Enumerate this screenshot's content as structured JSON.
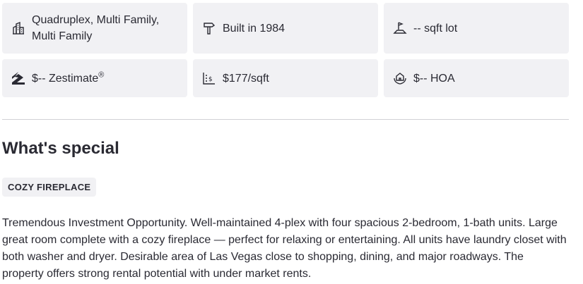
{
  "facts": [
    {
      "icon": "building-icon",
      "text": "Quadruplex, Multi Family, Multi Family"
    },
    {
      "icon": "hammer-icon",
      "text": "Built in 1984"
    },
    {
      "icon": "lot-size-icon",
      "text": "-- sqft lot"
    },
    {
      "icon": "zillow-logo-icon",
      "text": "$-- Zestimate",
      "suffix": "®"
    },
    {
      "icon": "price-per-sqft-icon",
      "text": "$177/sqft"
    },
    {
      "icon": "hoa-icon",
      "text": "$-- HOA"
    }
  ],
  "special": {
    "heading": "What's special",
    "tags": [
      "COZY FIREPLACE"
    ],
    "description": "Tremendous Investment Opportunity. Well-maintained 4-plex with four spacious 2-bedroom, 1-bath units. Large great room complete with a cozy fireplace — perfect for relaxing or entertaining. All units have laundry closet with both washer and dryer. Desirable area of Las Vegas close to shopping, dining, and major roadways. The property offers strong rental potential with under market rents."
  }
}
